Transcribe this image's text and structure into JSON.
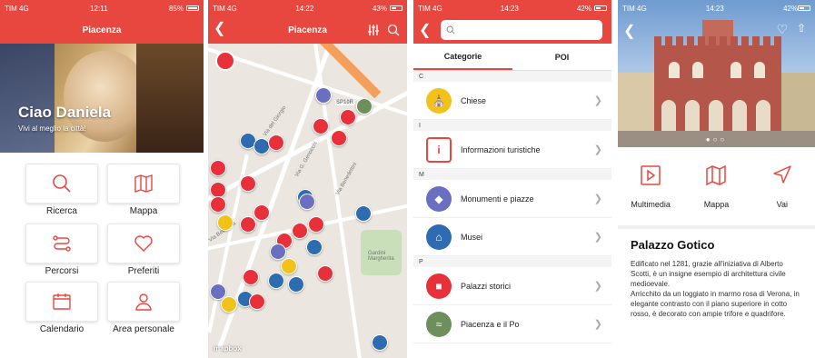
{
  "screen1": {
    "status": {
      "carrier": "TIM 4G",
      "time": "12:11",
      "battery": "85%"
    },
    "title": "Piacenza",
    "greeting": "Ciao Daniela",
    "subtitle": "Vivi al meglio la città!",
    "tiles": [
      {
        "label": "Ricerca",
        "icon": "search-icon"
      },
      {
        "label": "Mappa",
        "icon": "map-icon"
      },
      {
        "label": "Percorsi",
        "icon": "route-icon"
      },
      {
        "label": "Preferiti",
        "icon": "heart-icon"
      },
      {
        "label": "Calendario",
        "icon": "calendar-icon"
      },
      {
        "label": "Area personale",
        "icon": "user-icon"
      }
    ]
  },
  "screen2": {
    "status": {
      "carrier": "TIM 4G",
      "time": "14:22",
      "battery": "43%"
    },
    "title": "Piacenza",
    "map_labels": [
      "Via del Giorgio",
      "Via Beverora",
      "Gardini Margherita",
      "Via G. Genocchi",
      "Via Benedettini",
      "SP10R",
      "mapbox"
    ]
  },
  "screen3": {
    "status": {
      "carrier": "TIM 4G",
      "time": "14:23",
      "battery": "42%"
    },
    "search_placeholder": "",
    "tabs": [
      "Categorie",
      "POI"
    ],
    "sections": [
      {
        "letter": "C",
        "items": [
          {
            "label": "Chiese",
            "color": "#f2c21a",
            "icon": "church-icon"
          }
        ]
      },
      {
        "letter": "I",
        "items": [
          {
            "label": "Informazioni turistiche",
            "color": "#e8473f",
            "icon": "info-icon"
          }
        ]
      },
      {
        "letter": "M",
        "items": [
          {
            "label": "Monumenti e piazze",
            "color": "#6a6fbf",
            "icon": "monument-icon"
          },
          {
            "label": "Musei",
            "color": "#2e6bb0",
            "icon": "museum-icon"
          }
        ]
      },
      {
        "letter": "P",
        "items": [
          {
            "label": "Palazzi storici",
            "color": "#e8303a",
            "icon": "palace-icon"
          },
          {
            "label": "Piacenza e il Po",
            "color": "#6c8f5c",
            "icon": "river-icon"
          }
        ]
      }
    ]
  },
  "screen4": {
    "status": {
      "carrier": "TIM 4G",
      "time": "14:23",
      "battery": "42%"
    },
    "actions": [
      {
        "label": "Multimedia",
        "icon": "play-icon"
      },
      {
        "label": "Mappa",
        "icon": "map-icon"
      },
      {
        "label": "Vai",
        "icon": "navigate-icon"
      }
    ],
    "heading": "Palazzo Gotico",
    "paragraph1": "Edificato nel 1281, grazie all'iniziativa di Alberto Scotti, è un insigne esempio di architettura civile medioevale.",
    "paragraph2": "Arricchito da un loggiato in marmo rosa di Verona, in elegante contrasto con il piano superiore in cotto rosso, è decorato con ampie trifore e quadrifore.",
    "colors": {
      "accent": "#e8473f"
    }
  }
}
